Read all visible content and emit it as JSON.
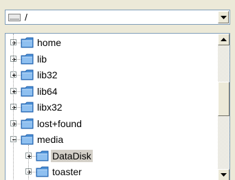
{
  "path_combo": {
    "value": "/"
  },
  "tree": {
    "items": [
      {
        "label": "home",
        "state": "collapsed",
        "level": 0
      },
      {
        "label": "lib",
        "state": "collapsed",
        "level": 0
      },
      {
        "label": "lib32",
        "state": "collapsed",
        "level": 0
      },
      {
        "label": "lib64",
        "state": "collapsed",
        "level": 0
      },
      {
        "label": "libx32",
        "state": "collapsed",
        "level": 0
      },
      {
        "label": "lost+found",
        "state": "collapsed",
        "level": 0
      },
      {
        "label": "media",
        "state": "expanded",
        "level": 0
      },
      {
        "label": "DataDisk",
        "state": "collapsed",
        "level": 1,
        "selected": true
      },
      {
        "label": "toaster",
        "state": "collapsed",
        "level": 1
      }
    ]
  },
  "colors": {
    "folder": "#4a8fd6",
    "selection": "#d4d0c8",
    "border": "#7f9db9"
  },
  "icons": {
    "drive": "drive-icon",
    "folder": "folder-icon",
    "expand": "plus-icon",
    "collapse": "minus-icon"
  }
}
